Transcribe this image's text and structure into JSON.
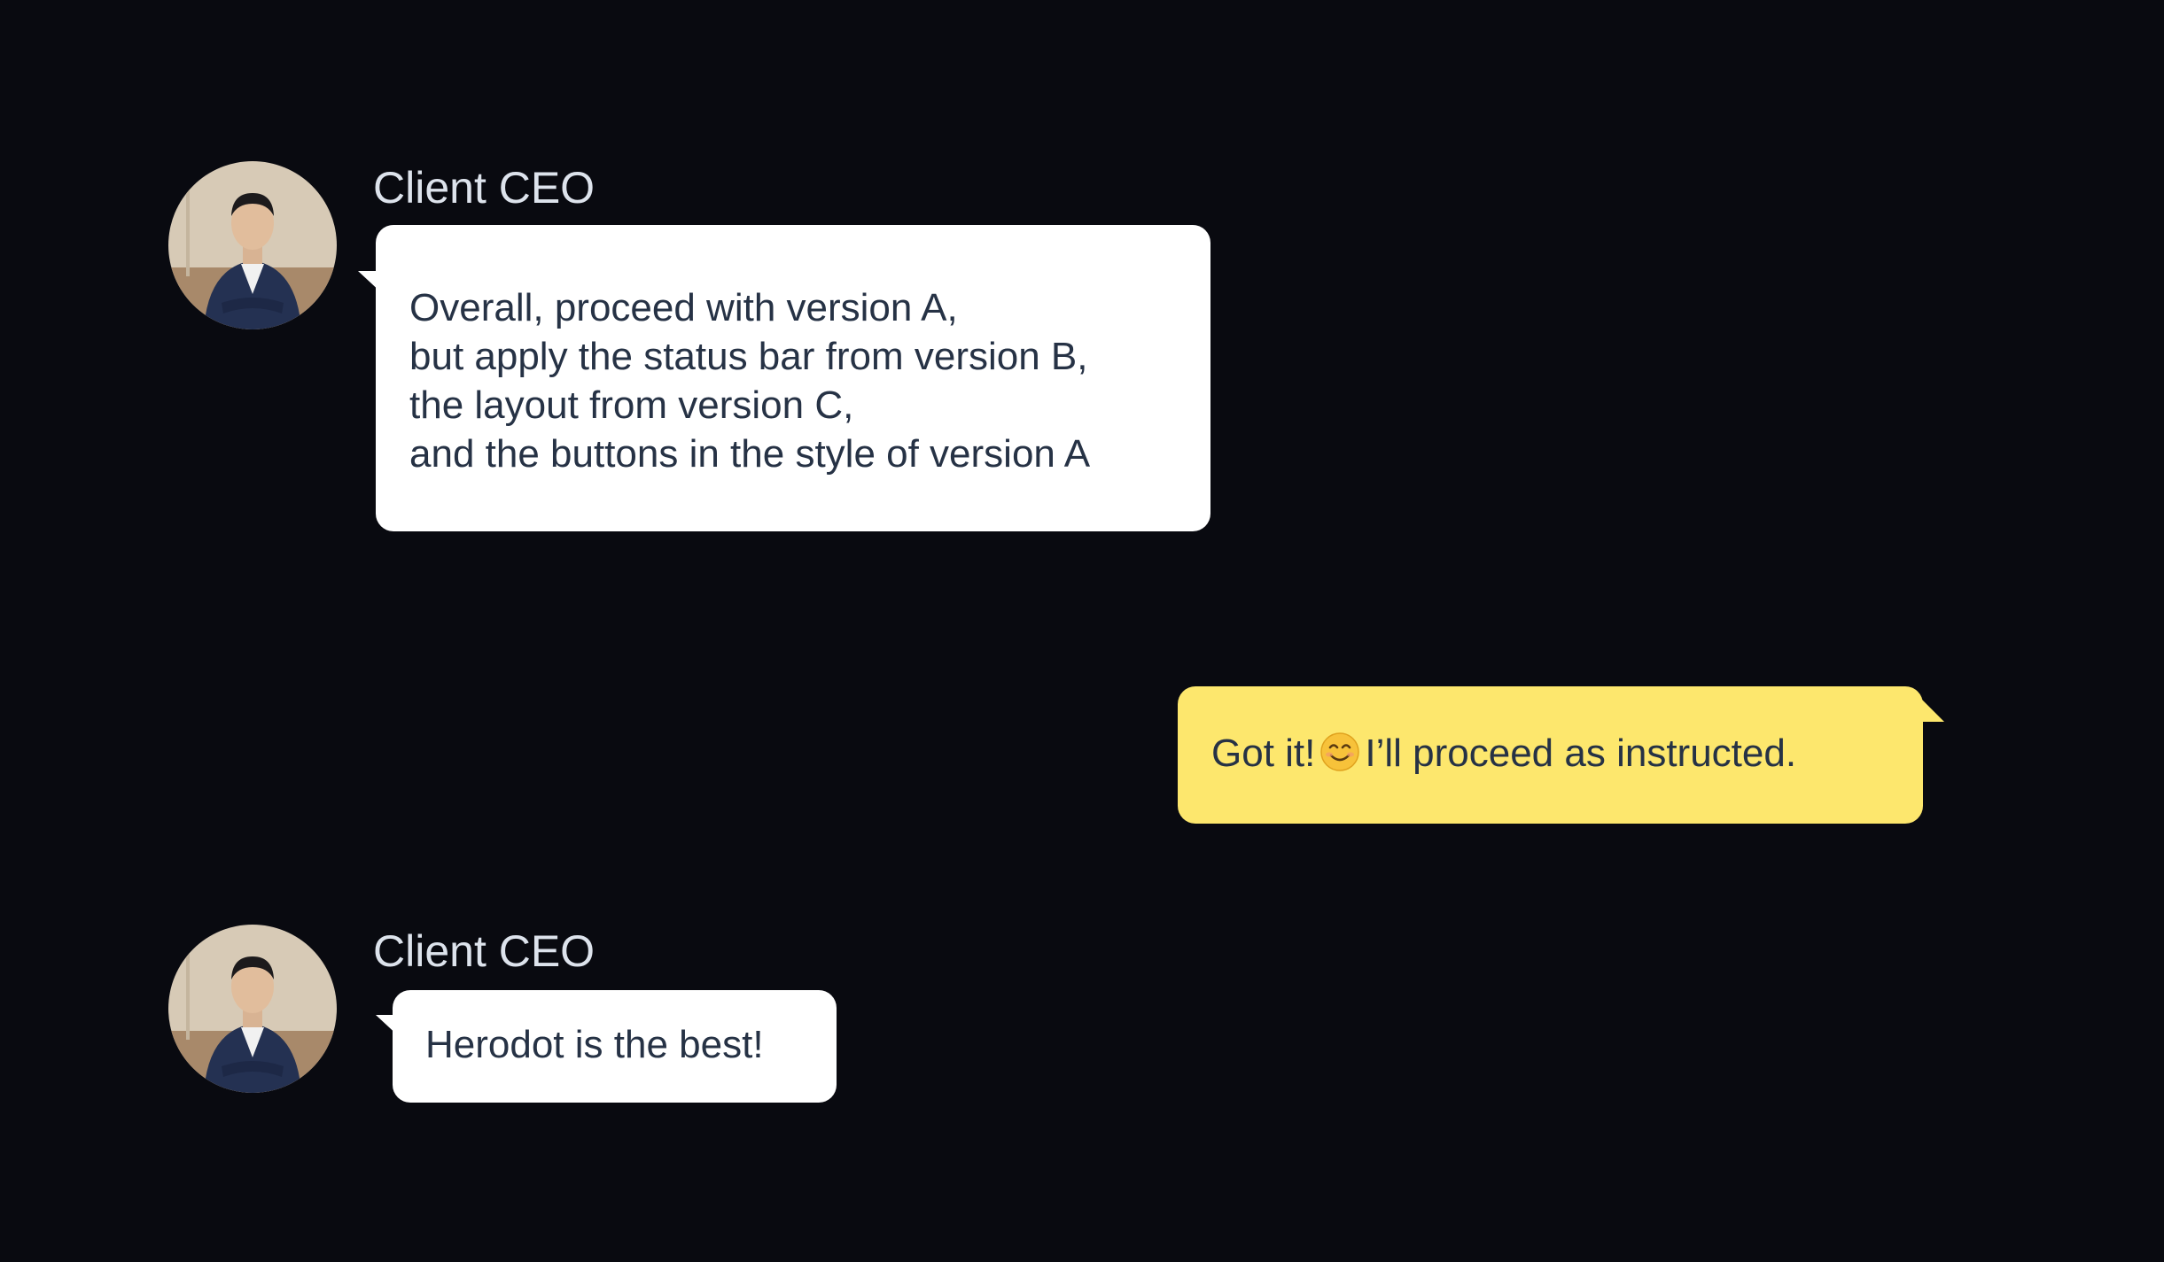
{
  "colors": {
    "background": "#090a10",
    "incoming_bubble": "#ffffff",
    "outgoing_bubble": "#fde76d",
    "message_text": "#263245",
    "sender_name": "#dde3ec"
  },
  "messages": [
    {
      "direction": "incoming",
      "sender": "Client CEO",
      "avatar_icon": "ceo-portrait-avatar",
      "lines": [
        "Overall, proceed with version A,",
        "but apply the status bar from version B,",
        "the layout from version C,",
        "and the buttons in the style of version A"
      ]
    },
    {
      "direction": "outgoing",
      "text_before_emoji": "Got it!",
      "emoji": "smiling-face-emoji",
      "text_after_emoji": "I’ll proceed as instructed."
    },
    {
      "direction": "incoming",
      "sender": "Client CEO",
      "avatar_icon": "ceo-portrait-avatar",
      "lines": [
        "Herodot is the best!"
      ]
    }
  ]
}
